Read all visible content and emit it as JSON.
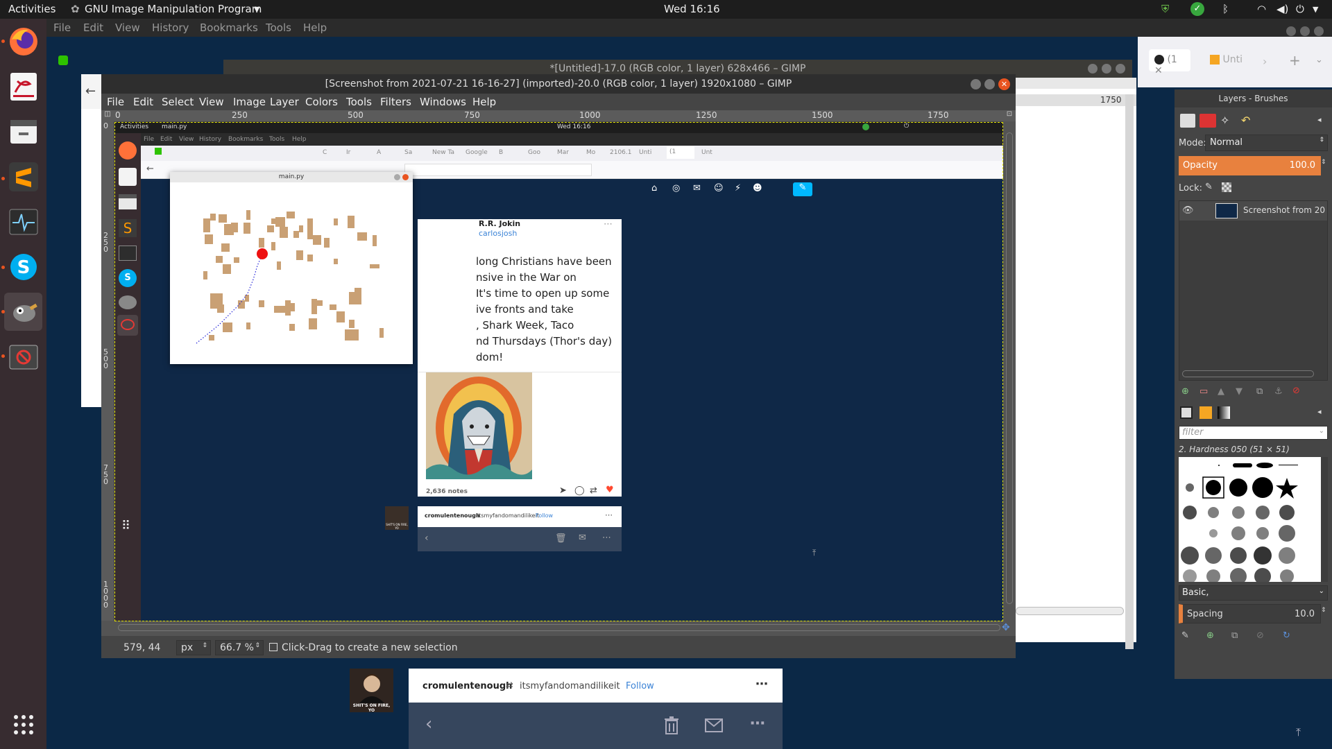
{
  "topbar": {
    "activities": "Activities",
    "app_menu": "GNU Image Manipulation Program",
    "clock": "Wed 16:16"
  },
  "firefox_menu": {
    "items": [
      "File",
      "Edit",
      "View",
      "History",
      "Bookmarks",
      "Tools",
      "Help"
    ]
  },
  "back_window": {
    "title": "*[Untitled]-17.0 (RGB color, 1 layer) 628x466 – GIMP",
    "tabs": [
      "(1",
      "Unti"
    ],
    "ruler_value": "1750"
  },
  "gimp": {
    "title": "[Screenshot from 2021-07-21 16-16-27] (imported)-20.0 (RGB color, 1 layer) 1920x1080 – GIMP",
    "menu": [
      "File",
      "Edit",
      "Select",
      "View",
      "Image",
      "Layer",
      "Colors",
      "Tools",
      "Filters",
      "Windows",
      "Help"
    ],
    "ruler_ticks": [
      "0",
      "250",
      "500",
      "750",
      "1000",
      "1250",
      "1500",
      "1750"
    ],
    "status": {
      "coords": "579, 44",
      "unit": "px",
      "zoom": "66.7 %",
      "message": "Click-Drag to create a new selection"
    }
  },
  "inner": {
    "activities": "Activities",
    "app_menu": "main.py",
    "clock": "Wed 16:16",
    "menu": [
      "File",
      "Edit",
      "View",
      "History",
      "Bookmarks",
      "Tools",
      "Help"
    ],
    "tabs": [
      "C",
      "Ir",
      "A",
      "Sa",
      "New Ta",
      "Google",
      "B",
      "Goo",
      "Mar",
      "Mo",
      "2106.1",
      "Unti",
      "(1",
      "Unt"
    ],
    "mainpy_title": "main.py",
    "post": {
      "author": "R.R. Jokin",
      "handle": "carlosjosh",
      "text_lines": [
        "long Christians have been",
        "nsive in the War on",
        "It's time to open up some",
        "ive fronts and take",
        ", Shark Week, Taco",
        "nd Thursdays (Thor's day)",
        "dom!"
      ],
      "notes": "2,636 notes"
    },
    "reblog": {
      "user": "cromulentenough",
      "source": "itsmyfandomandilikeit",
      "follow": "Follow",
      "avatar_caption": "SHIT'S ON FIRE, YO"
    }
  },
  "layers_panel": {
    "title": "Layers - Brushes",
    "mode_label": "Mode:",
    "mode_value": "Normal",
    "opacity_label": "Opacity",
    "opacity_value": "100.0",
    "lock_label": "Lock:",
    "layer_name": "Screenshot from 20",
    "filter_placeholder": "filter",
    "brush_name": "2. Hardness 050 (51 × 51)",
    "preset": "Basic,",
    "spacing_label": "Spacing",
    "spacing_value": "10.0"
  },
  "bottom_post": {
    "user": "cromulentenough",
    "source": "itsmyfandomandilikeit",
    "follow": "Follow",
    "avatar_caption": "SHIT'S ON FIRE, YO"
  },
  "colors": {
    "ubuntu_orange": "#e95420",
    "tumblr_navy": "#0f2847",
    "tumblr_blue": "#36465d",
    "follow_blue": "#3b83d6",
    "opacity_orange": "#e8813e"
  }
}
